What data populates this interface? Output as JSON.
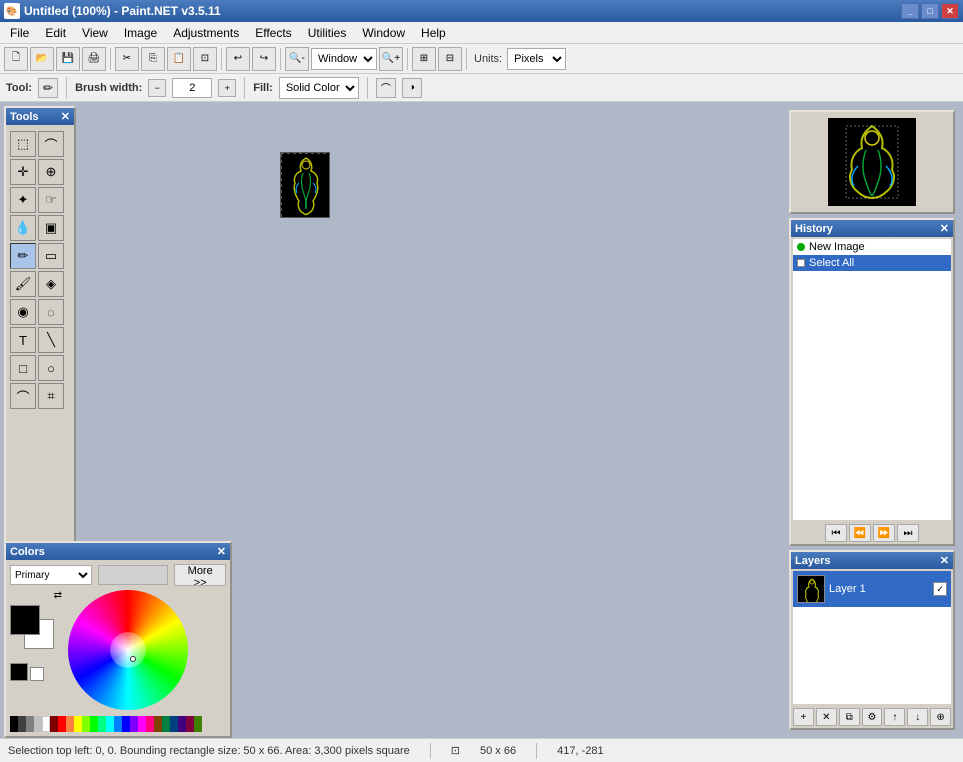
{
  "titlebar": {
    "title": "Untitled (100%) - Paint.NET v3.5.11",
    "icon": "🎨"
  },
  "menubar": {
    "items": [
      "File",
      "Edit",
      "View",
      "Image",
      "Adjustments",
      "Effects",
      "Utilities",
      "Window",
      "Help"
    ]
  },
  "toolbar": {
    "zoom_mode": "Window",
    "units_label": "Units:",
    "units_value": "Pixels"
  },
  "toolopts": {
    "tool_label": "Tool:",
    "brush_label": "Brush width:",
    "brush_value": "2",
    "fill_label": "Fill:",
    "fill_value": "Solid Color"
  },
  "tools_panel": {
    "title": "Tools",
    "tools": [
      {
        "name": "rectangle-select",
        "icon": "⬚",
        "row": 0
      },
      {
        "name": "lasso-select",
        "icon": "⌒",
        "row": 0
      },
      {
        "name": "move",
        "icon": "✛",
        "row": 1
      },
      {
        "name": "zoom",
        "icon": "🔍",
        "row": 1
      },
      {
        "name": "magic-wand",
        "icon": "✦",
        "row": 2
      },
      {
        "name": "zoom-out",
        "icon": "🔎",
        "row": 2
      },
      {
        "name": "pencil",
        "icon": "✏",
        "row": 3
      },
      {
        "name": "eraser",
        "icon": "▭",
        "row": 3
      },
      {
        "name": "paintbucket",
        "icon": "🪣",
        "row": 4
      },
      {
        "name": "color-picker",
        "icon": "💧",
        "row": 4
      },
      {
        "name": "clone-stamp",
        "icon": "◈",
        "row": 5
      },
      {
        "name": "recolor",
        "icon": "◉",
        "row": 5
      },
      {
        "name": "paintbrush",
        "icon": "🖌",
        "row": 6
      },
      {
        "name": "blur",
        "icon": "◌",
        "row": 6
      },
      {
        "name": "text",
        "icon": "T",
        "row": 7
      },
      {
        "name": "line",
        "icon": "╲",
        "row": 7
      },
      {
        "name": "shapes-rect",
        "icon": "□",
        "row": 8
      },
      {
        "name": "shapes-ellipse",
        "icon": "○",
        "row": 8
      },
      {
        "name": "freeform-shape",
        "icon": "⌒",
        "row": 9
      },
      {
        "name": "poly-select",
        "icon": "⌗",
        "row": 9
      }
    ]
  },
  "history_panel": {
    "title": "History",
    "items": [
      {
        "label": "New Image",
        "type": "dot",
        "selected": false
      },
      {
        "label": "Select All",
        "type": "page",
        "selected": true
      }
    ],
    "controls": [
      "first",
      "undo",
      "redo",
      "last"
    ]
  },
  "layers_panel": {
    "title": "Layers",
    "items": [
      {
        "name": "Layer 1",
        "visible": true,
        "selected": true
      }
    ],
    "controls": [
      "add",
      "delete",
      "duplicate",
      "properties",
      "up",
      "down",
      "merge"
    ]
  },
  "colors_panel": {
    "title": "Colors",
    "primary_label": "Primary",
    "more_btn": "More >>",
    "palette": [
      "#000000",
      "#404040",
      "#808080",
      "#c0c0c0",
      "#ffffff",
      "#800000",
      "#ff0000",
      "#ff8040",
      "#ffff00",
      "#80ff00",
      "#00ff00",
      "#00ff80",
      "#00ffff",
      "#0080ff",
      "#0000ff",
      "#8000ff",
      "#ff00ff",
      "#ff0080",
      "#804000",
      "#008040",
      "#004080",
      "#400080",
      "#800040",
      "#408000"
    ]
  },
  "statusbar": {
    "selection_info": "Selection top left: 0, 0. Bounding rectangle size: 50 x 66. Area: 3,300 pixels square",
    "dimensions": "50 x 66",
    "coords": "417, -281"
  }
}
